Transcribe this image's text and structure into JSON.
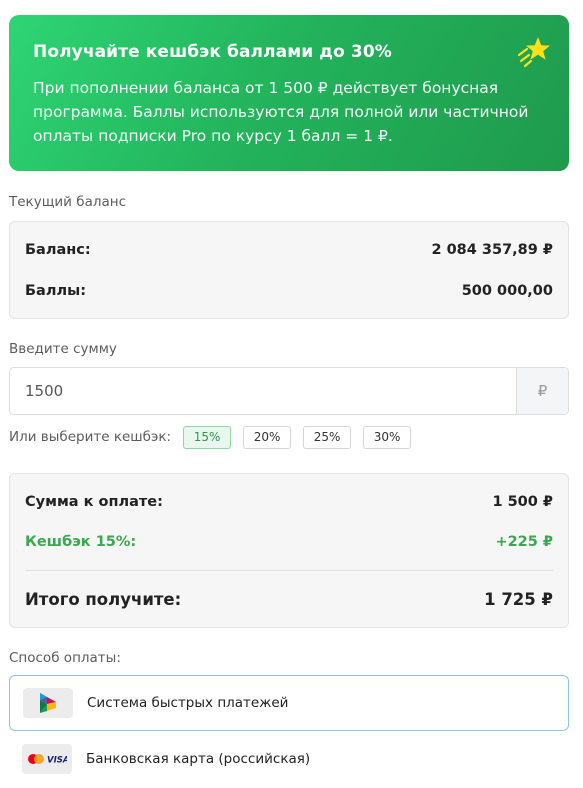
{
  "promo": {
    "title": "Получайте кешбэк баллами до 30%",
    "text": "При пополнении баланса от 1 500 ₽ действует бонусная программа. Баллы используются для полной или частичной оплаты подписки Pro по курсу 1 балл = 1 ₽.",
    "icon": "star-icon"
  },
  "balance": {
    "section_label": "Текущий баланс",
    "balance_label": "Баланс:",
    "balance_value": "2 084 357,89 ₽",
    "points_label": "Баллы:",
    "points_value": "500 000,00"
  },
  "amount": {
    "section_label": "Введите сумму",
    "value": "1500",
    "currency": "₽"
  },
  "cashback": {
    "label": "Или выберите кешбэк:",
    "options": [
      "15%",
      "20%",
      "25%",
      "30%"
    ],
    "selected": "15%"
  },
  "summary": {
    "pay_label": "Сумма к оплате:",
    "pay_value": "1 500 ₽",
    "cashback_label": "Кешбэк 15%:",
    "cashback_value": "+225 ₽",
    "total_label": "Итого получите:",
    "total_value": "1 725 ₽",
    "accent_color": "#3aa84f"
  },
  "payment": {
    "section_label": "Способ оплаты:",
    "methods": [
      {
        "label": "Система быстрых платежей",
        "icon": "sbp-icon",
        "selected": true
      },
      {
        "label": "Банковская карта (российская)",
        "icon": "card-brands-icon",
        "selected": false,
        "icon_text": "VISA"
      }
    ]
  }
}
